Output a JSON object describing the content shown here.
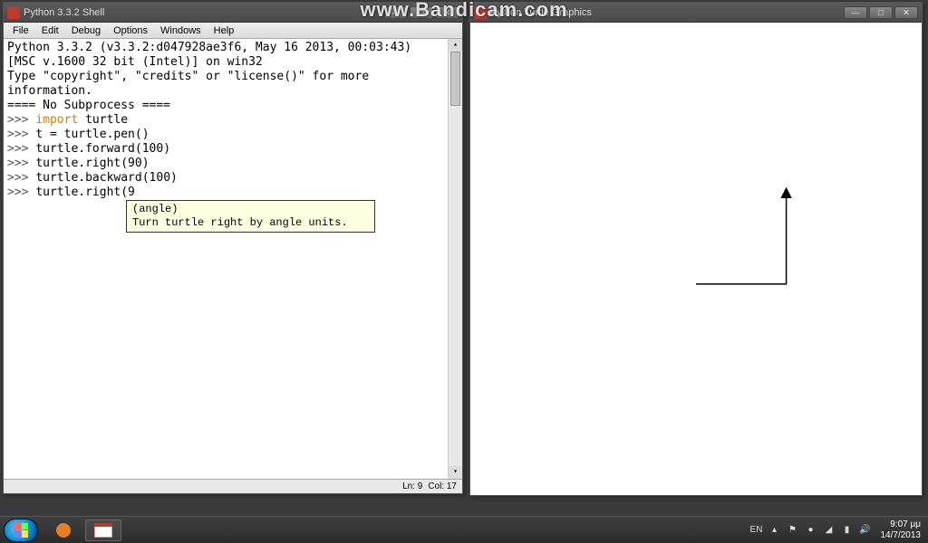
{
  "watermark": "www.Bandicam.com",
  "idle_window": {
    "title": "Python 3.3.2 Shell",
    "menu": [
      "File",
      "Edit",
      "Debug",
      "Options",
      "Windows",
      "Help"
    ],
    "banner": "Python 3.3.2 (v3.3.2:d047928ae3f6, May 16 2013, 00:03:43)\n[MSC v.1600 32 bit (Intel)] on win32\nType \"copyright\", \"credits\" or \"license()\" for more information.\n==== No Subprocess ====",
    "lines": [
      {
        "prompt": ">>>",
        "kw": "import",
        "rest": " turtle"
      },
      {
        "prompt": ">>>",
        "kw": "",
        "rest": "t = turtle.pen()"
      },
      {
        "prompt": ">>>",
        "kw": "",
        "rest": "turtle.forward(100)"
      },
      {
        "prompt": ">>>",
        "kw": "",
        "rest": "turtle.right(90)"
      },
      {
        "prompt": ">>>",
        "kw": "",
        "rest": "turtle.backward(100)"
      },
      {
        "prompt": ">>>",
        "kw": "",
        "rest": "turtle.right(9"
      }
    ],
    "tooltip": {
      "sig": "(angle)",
      "doc": "Turn turtle right by angle units."
    },
    "status": {
      "ln": "Ln: 9",
      "col": "Col: 17"
    }
  },
  "turtle_window": {
    "title": "Python Turtle Graphics"
  },
  "taskbar": {
    "lang": "EN",
    "time": "9:07 μμ",
    "date": "14/7/2013"
  }
}
